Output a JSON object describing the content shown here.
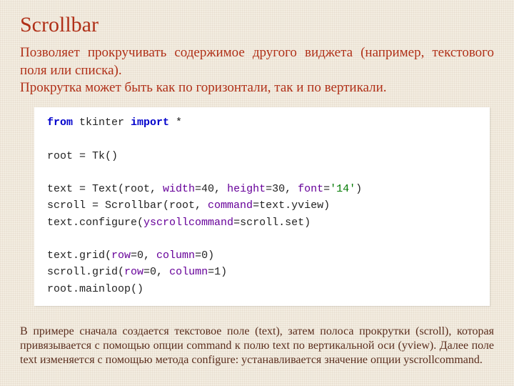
{
  "title": "Scrollbar",
  "intro_line1": "Позволяет прокручивать содержимое другого виджета (например, текстового поля или списка).",
  "intro_line2": "Прокрутка может быть как по горизонтали, так и по вертикали.",
  "code": {
    "kw_from": "from",
    "mod": " tkinter ",
    "kw_import": "import",
    "star": " *",
    "l2": "root = Tk()",
    "l3_a": "text = Text(root, ",
    "arg_width": "width",
    "l3_b": "=40, ",
    "arg_height": "height",
    "l3_c": "=30, ",
    "arg_font": "font",
    "l3_d": "=",
    "str_14": "'14'",
    "l3_e": ")",
    "l4_a": "scroll = Scrollbar(root, ",
    "arg_command": "command",
    "l4_b": "=text.yview)",
    "l5_a": "text.configure(",
    "arg_yscroll": "yscrollcommand",
    "l5_b": "=scroll.set)",
    "l6_a": "text.grid(",
    "arg_row": "row",
    "l6_b": "=0, ",
    "arg_col": "column",
    "l6_c": "=0)",
    "l7_a": "scroll.grid(",
    "l7_b": "=0, ",
    "l7_c": "=1)",
    "l8": "root.mainloop()"
  },
  "outro": "В примере сначала создается текстовое поле (text), затем полоса прокрутки (scroll), которая привязывается с помощью опции command к полю text по вертикальной оси (yview). Далее поле text изменяется с помощью метода configure: устанавливается значение опции yscrollcommand."
}
